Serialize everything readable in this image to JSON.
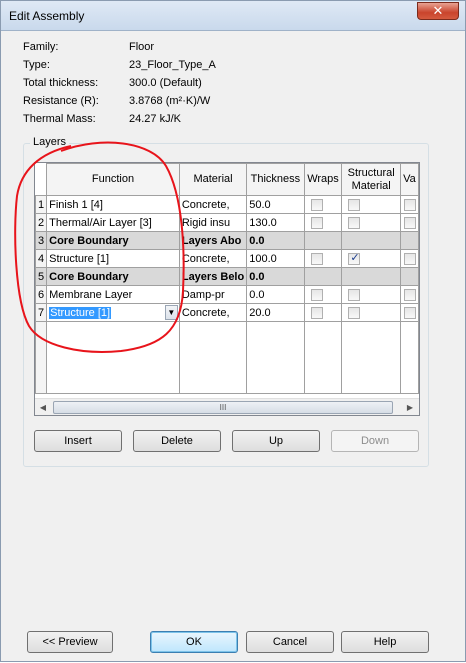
{
  "window": {
    "title": "Edit Assembly",
    "close_glyph": "✕"
  },
  "properties": [
    {
      "label": "Family:",
      "value": "Floor"
    },
    {
      "label": "Type:",
      "value": "23_Floor_Type_A"
    },
    {
      "label": "Total thickness:",
      "value": "300.0 (Default)"
    },
    {
      "label": "Resistance (R):",
      "value": "3.8768 (m²·K)/W"
    },
    {
      "label": "Thermal Mass:",
      "value": "24.27 kJ/K"
    }
  ],
  "layers": {
    "legend": "Layers",
    "columns": {
      "function": "Function",
      "material": "Material",
      "thickness": "Thickness",
      "wraps": "Wraps",
      "structural": "Structural Material",
      "variable": "Va"
    },
    "rows": [
      {
        "num": "1",
        "function": "Finish 1 [4]",
        "material": "Concrete,",
        "thickness": "50.0",
        "wraps": false,
        "structural": false,
        "bold": false
      },
      {
        "num": "2",
        "function": "Thermal/Air Layer [3]",
        "material": "Rigid insu",
        "thickness": "130.0",
        "wraps": false,
        "structural": false,
        "bold": false
      },
      {
        "num": "3",
        "function": "Core Boundary",
        "material": "Layers Abo",
        "thickness": "0.0",
        "bold": true
      },
      {
        "num": "4",
        "function": "Structure [1]",
        "material": "Concrete,",
        "thickness": "100.0",
        "wraps": false,
        "structural": true,
        "bold": false
      },
      {
        "num": "5",
        "function": "Core Boundary",
        "material": "Layers Belo",
        "thickness": "0.0",
        "bold": true
      },
      {
        "num": "6",
        "function": "Membrane Layer",
        "material": "Damp-pr",
        "thickness": "0.0",
        "wraps": false,
        "structural": false,
        "bold": false
      },
      {
        "num": "7",
        "function": "Structure [1]",
        "material": "Concrete,",
        "thickness": "20.0",
        "wraps": false,
        "structural": false,
        "bold": false,
        "selected": true
      }
    ],
    "scroll_thumb_glyph": "III",
    "scroll_left_glyph": "◀",
    "scroll_right_glyph": "▶"
  },
  "buttons": {
    "insert": "Insert",
    "delete": "Delete",
    "up": "Up",
    "down": "Down"
  },
  "footer": {
    "preview": "<< Preview",
    "ok": "OK",
    "cancel": "Cancel",
    "help": "Help"
  },
  "colors": {
    "selection": "#3399ff",
    "annotation": "#e8141b",
    "titlebar": "#c9d9ec"
  },
  "icons": {
    "dropdown": "chevron-down-icon",
    "close": "close-icon"
  }
}
